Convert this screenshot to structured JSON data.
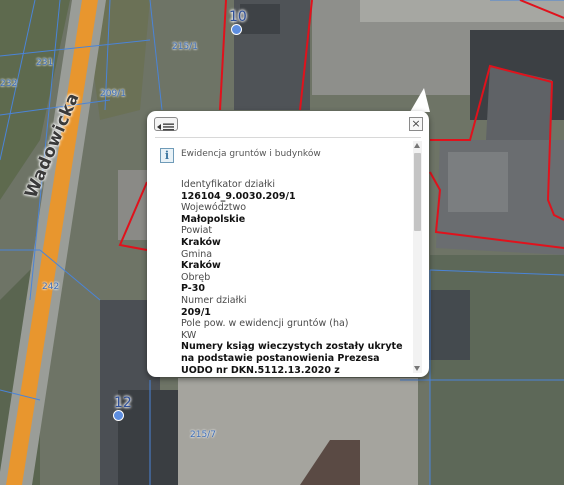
{
  "map": {
    "street_name": "Wadowicka",
    "address_numbers": [
      "10",
      "12"
    ],
    "plot_labels": [
      "215/1",
      "231",
      "232",
      "209/1",
      "242",
      "215/7"
    ]
  },
  "popup": {
    "menu_icon": "menu-list-icon",
    "close_icon": "close-icon",
    "info_icon": "info-icon",
    "info_icon_glyph": "i",
    "close_glyph": "×",
    "layer_title": "Ewidencja gruntów i budynków",
    "fields": [
      {
        "label": "Identyfikator działki",
        "value": "126104_9.0030.209/1"
      },
      {
        "label": "Województwo",
        "value": "Małopolskie"
      },
      {
        "label": "Powiat",
        "value": "Kraków"
      },
      {
        "label": "Gmina",
        "value": "Kraków"
      },
      {
        "label": "Obręb",
        "value": "P-30"
      },
      {
        "label": "Numer działki",
        "value": "209/1"
      },
      {
        "label": "Pole pow. w ewidencji gruntów (ha)",
        "value": ""
      },
      {
        "label": "KW",
        "value": "Numery ksiąg wieczystych zostały ukryte na podstawie postanowienia Prezesa UODO nr DKN.5112.13.2020 z"
      }
    ]
  },
  "colors": {
    "plot_boundary": "#e0121c",
    "parcel_line": "#4a84d8",
    "road_stripe": "#e8962e"
  }
}
